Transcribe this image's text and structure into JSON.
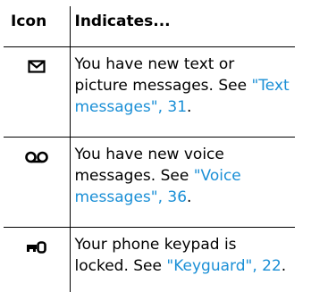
{
  "table": {
    "headers": {
      "icon": "Icon",
      "indicates": "Indicates..."
    },
    "rows": [
      {
        "icon": "envelope-icon",
        "text_before": "You have new text or picture messages. See ",
        "link_text": "\"Text messages\", 31",
        "text_after": "."
      },
      {
        "icon": "voicemail-icon",
        "text_before": "You have new voice messages. See ",
        "link_text": "\"Voice messages\", 36",
        "text_after": "."
      },
      {
        "icon": "key-icon",
        "text_before": "Your phone keypad is locked. See ",
        "link_text": "\"Keyguard\", 22",
        "text_after": "."
      }
    ]
  },
  "colors": {
    "link": "#1a8fd6",
    "border": "#000000",
    "text": "#000000"
  }
}
